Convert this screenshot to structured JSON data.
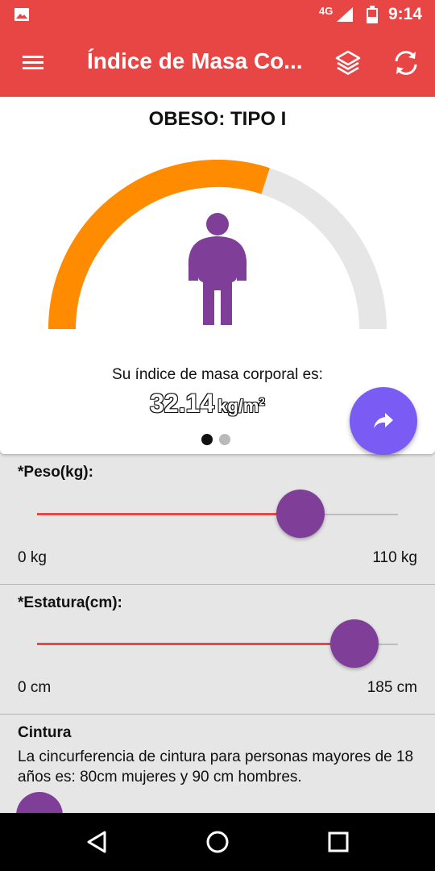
{
  "status_bar": {
    "network": "4G",
    "time": "9:14",
    "icons": [
      "image-icon",
      "signal-icon",
      "battery-icon"
    ]
  },
  "app_bar": {
    "title": "Índice de Masa Co...",
    "icons": [
      "menu-icon",
      "layers-icon",
      "refresh-icon"
    ]
  },
  "result_card": {
    "category": "OBESO: TIPO I",
    "label": "Su índice de masa corporal es:",
    "bmi_value": "32.14",
    "bmi_unit": "kg/m",
    "bmi_unit_sup": "2",
    "gauge_fill": 0.6,
    "colors": {
      "gauge_fill": "#ff8c00",
      "gauge_track": "#e6e6e6",
      "figure": "#7f3f98"
    },
    "pager": {
      "pages": 2,
      "active": 0
    }
  },
  "fab": {
    "icon": "share-icon",
    "color": "#7a5cf5"
  },
  "weight": {
    "label": "*Peso(kg):",
    "min_label": "0 kg",
    "max_label": "110 kg",
    "fraction": 0.73
  },
  "height": {
    "label": "*Estatura(cm):",
    "min_label": "0 cm",
    "max_label": "185 cm",
    "fraction": 0.88
  },
  "waist": {
    "title": "Cintura",
    "description": "La cincurferencia de cintura para personas mayores de 18 años es: 80cm mujeres y 90 cm hombres."
  },
  "nav_bar": {
    "icons": [
      "back-icon",
      "home-icon",
      "recents-icon"
    ]
  },
  "colors": {
    "primary": "#e84545",
    "slider_fill": "#e04a4a",
    "slider_thumb": "#7f3f98"
  }
}
